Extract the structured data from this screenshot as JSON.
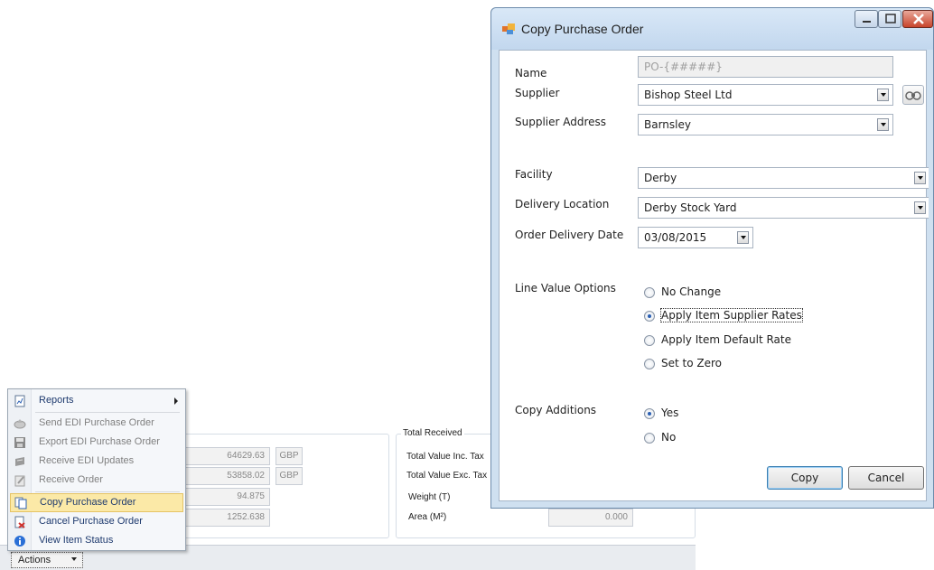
{
  "background": {
    "group_title": "Total Received",
    "left_values": [
      {
        "value": "64629.63",
        "currency": "GBP"
      },
      {
        "value": "53858.02",
        "currency": "GBP"
      },
      {
        "value": "94.875"
      },
      {
        "value": "1252.638"
      }
    ],
    "right_labels": [
      "Total Value Inc. Tax",
      "Total Value Exc. Tax",
      "Weight (T)",
      "Area (M²)"
    ],
    "right_area_value": "0.000",
    "actions_label": "Actions"
  },
  "context_menu": {
    "items": [
      {
        "label": "Reports",
        "icon": "report-icon",
        "enabled": true,
        "submenu": true
      },
      {
        "label": "Send EDI Purchase Order",
        "icon": "send-icon",
        "enabled": false
      },
      {
        "label": "Export EDI Purchase Order",
        "icon": "save-icon",
        "enabled": false
      },
      {
        "label": "Receive EDI Updates",
        "icon": "receive-icon",
        "enabled": false
      },
      {
        "label": "Receive Order",
        "icon": "edit-icon",
        "enabled": false
      },
      {
        "label": "Copy Purchase Order",
        "icon": "copy-icon",
        "enabled": true,
        "highlighted": true
      },
      {
        "label": "Cancel Purchase Order",
        "icon": "cancel-icon",
        "enabled": true
      },
      {
        "label": "View Item Status",
        "icon": "info-icon",
        "enabled": true
      }
    ]
  },
  "dialog": {
    "title": "Copy Purchase Order",
    "name_label": "Name",
    "name_placeholder": "PO-{#####}",
    "supplier_label": "Supplier",
    "supplier_value": "Bishop Steel Ltd",
    "supplier_address_label": "Supplier Address",
    "supplier_address_value": "Barnsley",
    "facility_label": "Facility",
    "facility_value": "Derby",
    "delivery_location_label": "Delivery Location",
    "delivery_location_value": "Derby Stock Yard",
    "order_delivery_date_label": "Order Delivery Date",
    "order_delivery_date_value": "03/08/2015",
    "line_value_options_label": "Line Value Options",
    "line_value_options": [
      {
        "label": "No Change",
        "checked": false
      },
      {
        "label": "Apply Item Supplier Rates",
        "checked": true
      },
      {
        "label": "Apply Item Default Rate",
        "checked": false
      },
      {
        "label": "Set to Zero",
        "checked": false
      }
    ],
    "copy_additions_label": "Copy Additions",
    "copy_additions_options": [
      {
        "label": "Yes",
        "checked": true
      },
      {
        "label": "No",
        "checked": false
      }
    ],
    "copy_button": "Copy",
    "cancel_button": "Cancel"
  },
  "colors": {
    "menu_highlight": "#fbe9a7",
    "dialog_frame": "#cfe0f0",
    "radio_dot": "#2a5fb3"
  }
}
